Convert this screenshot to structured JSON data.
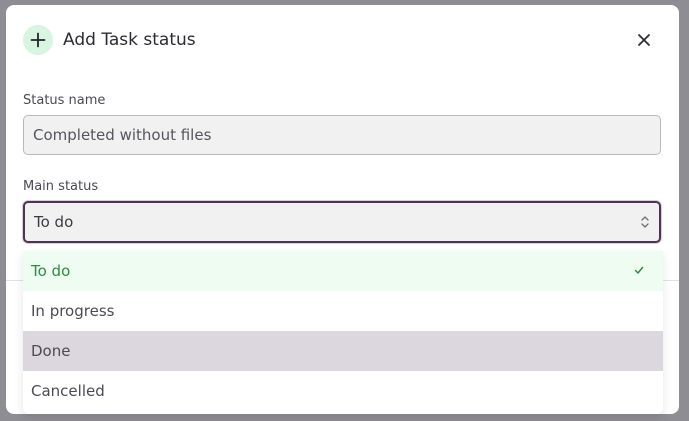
{
  "dialog": {
    "title": "Add Task status",
    "icons": {
      "add": "plus-icon",
      "close": "close-icon"
    }
  },
  "form": {
    "status_name": {
      "label": "Status name",
      "value": "Completed without files"
    },
    "main_status": {
      "label": "Main status",
      "selected": "To do",
      "options": [
        {
          "label": "To do",
          "state": "selected"
        },
        {
          "label": "In progress",
          "state": "normal"
        },
        {
          "label": "Done",
          "state": "hovered"
        },
        {
          "label": "Cancelled",
          "state": "normal"
        }
      ]
    }
  },
  "colors": {
    "accent_green": "#2f8a45",
    "selected_bg": "#effcf2",
    "hover_bg": "#dcd6de",
    "focus_border": "#4d3550",
    "overlay": "#8e8d93"
  }
}
